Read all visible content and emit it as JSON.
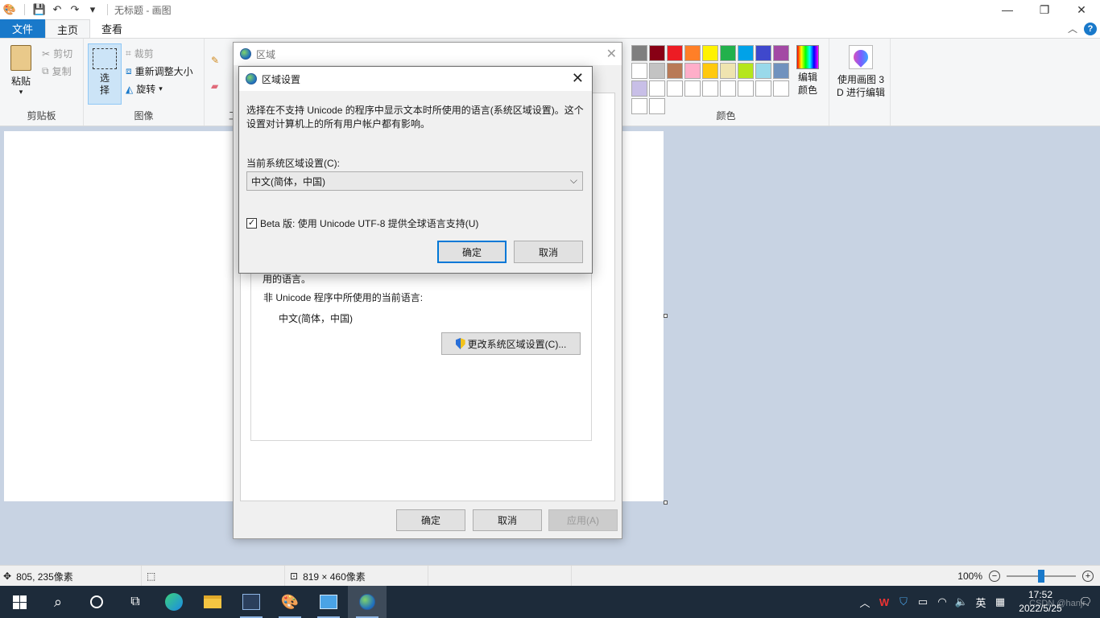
{
  "window": {
    "title": "无标题 - 画图"
  },
  "tabs": {
    "file": "文件",
    "home": "主页",
    "view": "查看"
  },
  "ribbon": {
    "clipboard": {
      "paste": "粘贴",
      "cut": "剪切",
      "copy": "复制",
      "label": "剪贴板"
    },
    "image": {
      "select": "选\n择",
      "crop": "裁剪",
      "resize": "重新调整大小",
      "rotate": "旋转",
      "label": "图像"
    },
    "tools": {
      "label_partial": "工"
    },
    "colors": {
      "label": "颜色",
      "edit": "编辑\n颜色",
      "swatches": [
        "#000000",
        "#7f7f7f",
        "#880015",
        "#ed1c24",
        "#ff7f27",
        "#fff200",
        "#22b14c",
        "#00a2e8",
        "#3f48cc",
        "#a349a4",
        "#ffffff",
        "#c3c3c3",
        "#b97a57",
        "#ffaec9",
        "#ffc90e",
        "#efe4b0",
        "#b5e61d",
        "#99d9ea",
        "#7092be",
        "#c8bfe7",
        "#ffffff",
        "#ffffff",
        "#ffffff",
        "#ffffff",
        "#ffffff",
        "#ffffff",
        "#ffffff",
        "#ffffff",
        "#ffffff",
        "#ffffff"
      ]
    },
    "paint3d": {
      "label": "使用画图 3\nD 进行编辑"
    }
  },
  "status": {
    "cursor": "805, 235像素",
    "size": "819 × 460像素",
    "zoom": "100%",
    "zoom_level_percent": 100
  },
  "taskbar": {
    "time": "17:52",
    "date": "2022/5/25",
    "ime": "英",
    "watermark": "CSDN @hanjr"
  },
  "region_dialog": {
    "title": "区域",
    "tail_text": "用的语言。",
    "non_unicode_label": "非 Unicode 程序中所使用的当前语言:",
    "current_lang": "中文(简体，中国)",
    "change_button": "更改系统区域设置(C)...",
    "ok": "确定",
    "cancel": "取消",
    "apply": "应用(A)"
  },
  "region_settings": {
    "title": "区域设置",
    "description": "选择在不支持 Unicode 的程序中显示文本时所使用的语言(系统区域设置)。这个设置对计算机上的所有用户帐户都有影响。",
    "current_label": "当前系统区域设置(C):",
    "selected": "中文(简体，中国)",
    "beta_label": "Beta 版: 使用 Unicode UTF-8 提供全球语言支持(U)",
    "beta_checked": "✓",
    "ok": "确定",
    "cancel": "取消"
  }
}
